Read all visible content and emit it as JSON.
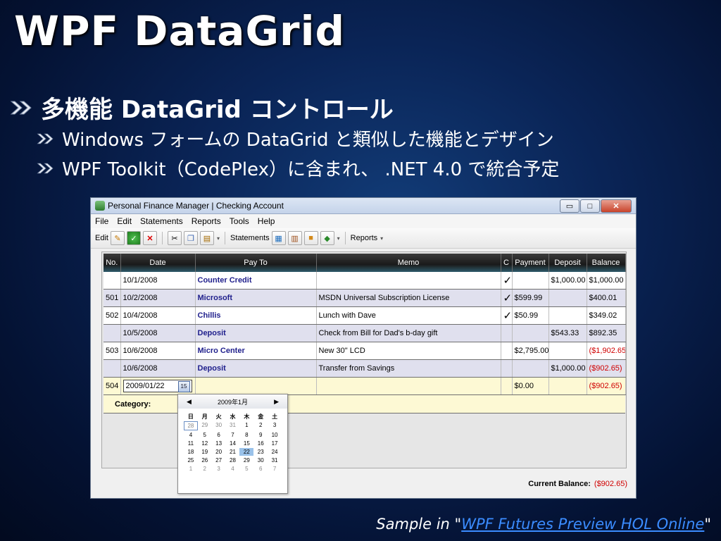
{
  "slide": {
    "title": "WPF DataGrid",
    "bullet_main": "多機能 DataGrid コントロール",
    "bullet_sub1": "Windows フォームの DataGrid と類似した機能とデザイン",
    "bullet_sub2": "WPF Toolkit（CodePlex）に含まれ、 .NET 4.0 で統合予定",
    "footer_prefix": "Sample in \"",
    "footer_link": "WPF Futures Preview HOL Online",
    "footer_suffix": "\""
  },
  "window": {
    "title": "Personal Finance Manager | Checking Account",
    "controls": {
      "minimize": "▭",
      "maximize": "□",
      "close": "✕"
    },
    "menu": [
      "File",
      "Edit",
      "Statements",
      "Reports",
      "Tools",
      "Help"
    ],
    "toolbar": {
      "edit_label": "Edit",
      "statements_label": "Statements",
      "reports_label": "Reports",
      "edit_icons": [
        "pencil-icon",
        "ok-icon",
        "delete-icon"
      ],
      "clipboard_icons": [
        "cut-icon",
        "copy-icon",
        "paste-icon"
      ],
      "statement_icons": [
        "statement-icon",
        "books-icon",
        "folder-icon",
        "tag-icon"
      ]
    },
    "grid": {
      "columns": [
        "No.",
        "Date",
        "Pay To",
        "Memo",
        "C",
        "Payment",
        "Deposit",
        "Balance"
      ],
      "rows": [
        {
          "no": "",
          "date": "10/1/2008",
          "payto": "Counter Credit",
          "memo": "",
          "c": "✓",
          "payment": "",
          "deposit": "$1,000.00",
          "balance": "$1,000.00",
          "neg": false
        },
        {
          "no": "501",
          "date": "10/2/2008",
          "payto": "Microsoft",
          "memo": "MSDN Universal Subscription License",
          "c": "✓",
          "payment": "$599.99",
          "deposit": "",
          "balance": "$400.01",
          "neg": false
        },
        {
          "no": "502",
          "date": "10/4/2008",
          "payto": "Chillis",
          "memo": "Lunch with Dave",
          "c": "✓",
          "payment": "$50.99",
          "deposit": "",
          "balance": "$349.02",
          "neg": false
        },
        {
          "no": "",
          "date": "10/5/2008",
          "payto": "Deposit",
          "memo": "Check from Bill for Dad's b-day gift",
          "c": "",
          "payment": "",
          "deposit": "$543.33",
          "balance": "$892.35",
          "neg": false
        },
        {
          "no": "503",
          "date": "10/6/2008",
          "payto": "Micro Center",
          "memo": "New 30\" LCD",
          "c": "",
          "payment": "$2,795.00",
          "deposit": "",
          "balance": "($1,902.65)",
          "neg": true
        },
        {
          "no": "",
          "date": "10/6/2008",
          "payto": "Deposit",
          "memo": "Transfer from Savings",
          "c": "",
          "payment": "",
          "deposit": "$1,000.00",
          "balance": "($902.65)",
          "neg": true
        }
      ],
      "edit_row": {
        "no": "504",
        "date_value": "2009/01/22",
        "payment": "$0.00",
        "balance": "($902.65)",
        "calendar_button": "15"
      },
      "category_label": "Category:"
    },
    "calendar": {
      "month_label": "2009年1月",
      "weekdays": [
        "日",
        "月",
        "火",
        "水",
        "木",
        "金",
        "土"
      ],
      "days": [
        [
          "28",
          "29",
          "30",
          "31",
          "1",
          "2",
          "3"
        ],
        [
          "4",
          "5",
          "6",
          "7",
          "8",
          "9",
          "10"
        ],
        [
          "11",
          "12",
          "13",
          "14",
          "15",
          "16",
          "17"
        ],
        [
          "18",
          "19",
          "20",
          "21",
          "22",
          "23",
          "24"
        ],
        [
          "25",
          "26",
          "27",
          "28",
          "29",
          "30",
          "31"
        ],
        [
          "1",
          "2",
          "3",
          "4",
          "5",
          "6",
          "7"
        ]
      ]
    },
    "status": {
      "label": "Current Balance:",
      "value": "($902.65)"
    }
  }
}
